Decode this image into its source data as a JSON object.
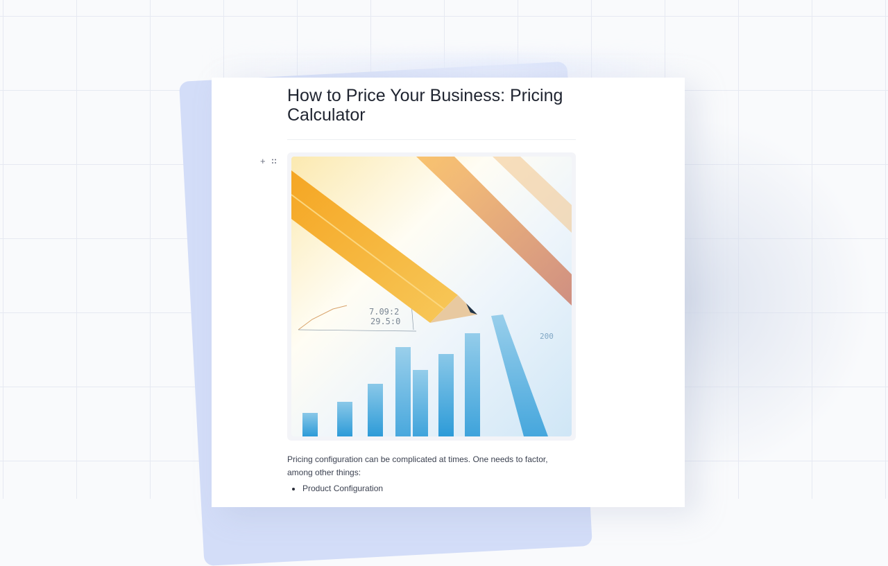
{
  "document": {
    "title": "How to Price Your Business: Pricing Calculator",
    "intro": "Pricing configuration can be complicated at times. One needs to factor, among other things:",
    "bullets": [
      "Product Configuration"
    ]
  },
  "editor": {
    "add_block_icon": "plus-icon",
    "drag_handle_icon": "drag-handle-icon"
  },
  "image": {
    "subject": "pencil-on-financial-bar-chart",
    "printed_numbers": [
      "7.09:2",
      "29.5:0",
      "200"
    ]
  },
  "colors": {
    "accent_card": "#d3ddf8",
    "title_text": "#1f2430",
    "body_text": "#3b4150"
  }
}
